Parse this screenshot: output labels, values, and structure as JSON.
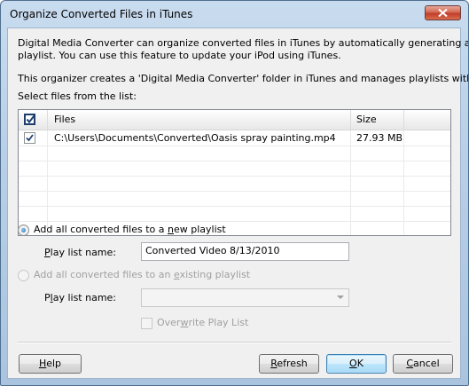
{
  "window": {
    "title": "Organize Converted Files in iTunes"
  },
  "intro": {
    "line1": "Digital Media Converter can organize converted files in iTunes by automatically generating an iTunes",
    "line2": "playlist. You can use this feature to update your iPod using iTunes.",
    "line3": "This organizer creates a 'Digital Media Converter' folder in iTunes and manages playlists within it.",
    "select_label": "Select files from the list:"
  },
  "file_list": {
    "columns": [
      "Files",
      "Size"
    ],
    "rows": [
      {
        "checked": true,
        "file": "C:\\Users\\Documents\\Converted\\Oasis spray painting.mp4",
        "size": "27.93 MB"
      }
    ]
  },
  "option_new": {
    "label_pre": "Add all converted files to a ",
    "label_mn": "n",
    "label_post": "ew playlist",
    "selected": true,
    "name_label_mn": "P",
    "name_label_rest": "lay list name:",
    "name_value": "Converted Video 8/13/2010"
  },
  "option_existing": {
    "label_pre": "Add all converted files to an ",
    "label_mn": "e",
    "label_post": "xisting playlist",
    "selected": false,
    "name_label_pre": "P",
    "name_label_mn": "l",
    "name_label_rest": "ay list name:",
    "name_value": "",
    "overwrite_pre": "Over",
    "overwrite_mn": "w",
    "overwrite_post": "rite Play List"
  },
  "buttons": {
    "help_mn": "H",
    "help_rest": "elp",
    "refresh_mn": "R",
    "refresh_rest": "efresh",
    "ok_mn": "O",
    "ok_rest": "K",
    "cancel_mn": "C",
    "cancel_rest": "ancel"
  },
  "colors": {
    "accent": "#3c7fb1",
    "title_bar": "#b8cfe7",
    "close_button": "#c0392b"
  }
}
